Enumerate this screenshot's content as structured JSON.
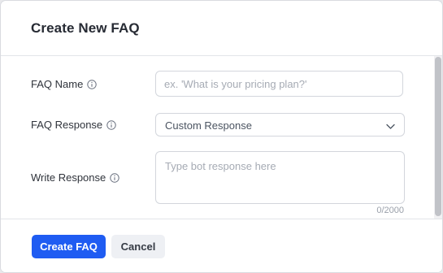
{
  "dialog": {
    "title": "Create New FAQ"
  },
  "form": {
    "faq_name": {
      "label": "FAQ Name",
      "icon": "info-icon",
      "value": "",
      "placeholder": "ex. 'What is your pricing plan?'"
    },
    "faq_response": {
      "label": "FAQ Response",
      "icon": "info-icon",
      "selected": "Custom Response",
      "dropdown_icon": "chevron-down-icon"
    },
    "write_response": {
      "label": "Write Response",
      "icon": "info-icon",
      "value": "",
      "placeholder": "Type bot response here",
      "counter": "0/2000"
    }
  },
  "footer": {
    "create_label": "Create FAQ",
    "cancel_label": "Cancel"
  },
  "colors": {
    "primary": "#1f5cf2",
    "secondary_bg": "#eef0f4",
    "border": "#d3d6dc",
    "placeholder": "#a6abb4",
    "text": "#2f333b"
  }
}
